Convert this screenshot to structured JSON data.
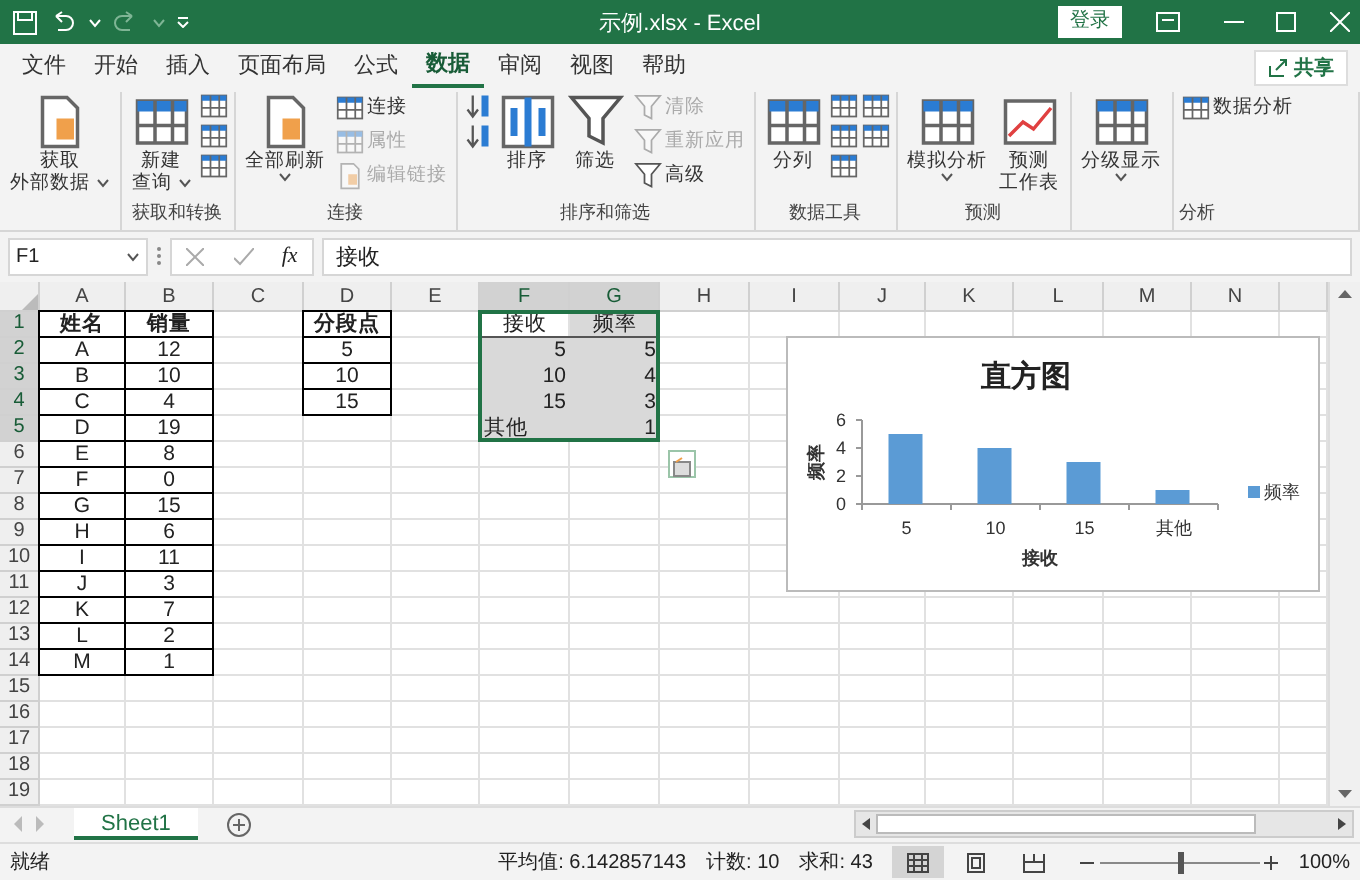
{
  "window": {
    "title": "示例.xlsx  -  Excel",
    "login_button": "登录"
  },
  "ribbon_tabs": [
    {
      "label": "文件",
      "selected": false
    },
    {
      "label": "开始",
      "selected": false
    },
    {
      "label": "插入",
      "selected": false
    },
    {
      "label": "页面布局",
      "selected": false
    },
    {
      "label": "公式",
      "selected": false
    },
    {
      "label": "数据",
      "selected": true
    },
    {
      "label": "审阅",
      "selected": false
    },
    {
      "label": "视图",
      "selected": false
    },
    {
      "label": "帮助",
      "selected": false
    }
  ],
  "share_button": "共享",
  "ribbon_groups": [
    {
      "commands": [
        {
          "kind": "large",
          "lines": [
            "获取",
            "外部数据"
          ],
          "dropdown": true
        }
      ]
    },
    {
      "label": "获取和转换",
      "commands": [
        {
          "kind": "large",
          "lines": [
            "新建",
            "查询"
          ],
          "dropdown": true
        },
        {
          "kind": "icon"
        },
        {
          "kind": "icon"
        },
        {
          "kind": "icon"
        }
      ]
    },
    {
      "label": "连接",
      "commands": [
        {
          "kind": "large",
          "lines": [
            "全部刷新"
          ],
          "dropdown": true
        },
        {
          "kind": "small",
          "label": "连接",
          "disabled": false
        },
        {
          "kind": "small",
          "label": "属性",
          "disabled": true
        },
        {
          "kind": "small",
          "label": "编辑链接",
          "disabled": true
        }
      ]
    },
    {
      "label": "排序和筛选",
      "commands": [
        {
          "kind": "icon"
        },
        {
          "kind": "icon"
        },
        {
          "kind": "large",
          "lines": [
            "排序"
          ]
        },
        {
          "kind": "large",
          "lines": [
            "筛选"
          ]
        },
        {
          "kind": "small",
          "label": "清除",
          "disabled": true
        },
        {
          "kind": "small",
          "label": "重新应用",
          "disabled": true
        },
        {
          "kind": "small",
          "label": "高级",
          "disabled": false
        }
      ]
    },
    {
      "label": "数据工具",
      "commands": [
        {
          "kind": "large",
          "lines": [
            "分列"
          ]
        },
        {
          "kind": "icon"
        },
        {
          "kind": "icon"
        },
        {
          "kind": "icon"
        },
        {
          "kind": "icon"
        },
        {
          "kind": "icon"
        }
      ]
    },
    {
      "label": "预测",
      "commands": [
        {
          "kind": "large",
          "lines": [
            "模拟分析"
          ],
          "dropdown": true
        },
        {
          "kind": "large",
          "lines": [
            "预测",
            "工作表"
          ]
        }
      ]
    },
    {
      "commands": [
        {
          "kind": "large",
          "lines": [
            "分级显示"
          ],
          "dropdown": true
        }
      ]
    },
    {
      "label": "分析",
      "commands": [
        {
          "kind": "small",
          "label": "数据分析",
          "disabled": false
        }
      ]
    }
  ],
  "formula_bar": {
    "name_box": "F1",
    "function_label": "fx",
    "formula": "接收"
  },
  "columns": [
    {
      "label": "A",
      "selected": false
    },
    {
      "label": "B",
      "selected": false
    },
    {
      "label": "C",
      "selected": false
    },
    {
      "label": "D",
      "selected": false
    },
    {
      "label": "E",
      "selected": false
    },
    {
      "label": "F",
      "selected": true
    },
    {
      "label": "G",
      "selected": true
    },
    {
      "label": "H",
      "selected": false
    },
    {
      "label": "I",
      "selected": false
    },
    {
      "label": "J",
      "selected": false
    },
    {
      "label": "K",
      "selected": false
    },
    {
      "label": "L",
      "selected": false
    },
    {
      "label": "M",
      "selected": false
    },
    {
      "label": "N",
      "selected": false
    }
  ],
  "rows": [
    {
      "label": "1",
      "selected": true,
      "cells": [
        {
          "text": "姓名",
          "kind": "header"
        },
        {
          "text": "销量",
          "kind": "header"
        },
        null,
        {
          "text": "分段点",
          "kind": "header"
        },
        null,
        {
          "text": "接收",
          "kind": "title",
          "active": true
        },
        {
          "text": "频率",
          "kind": "title"
        }
      ]
    },
    {
      "label": "2",
      "selected": true,
      "cells": [
        {
          "text": "A",
          "kind": "boxed"
        },
        {
          "text": "12",
          "kind": "boxed"
        },
        null,
        {
          "text": "5",
          "kind": "boxed"
        },
        null,
        {
          "text": "5",
          "kind": "number"
        },
        {
          "text": "5",
          "kind": "number"
        }
      ]
    },
    {
      "label": "3",
      "selected": true,
      "cells": [
        {
          "text": "B",
          "kind": "boxed"
        },
        {
          "text": "10",
          "kind": "boxed"
        },
        null,
        {
          "text": "10",
          "kind": "boxed"
        },
        null,
        {
          "text": "10",
          "kind": "number"
        },
        {
          "text": "4",
          "kind": "number"
        }
      ]
    },
    {
      "label": "4",
      "selected": true,
      "cells": [
        {
          "text": "C",
          "kind": "boxed"
        },
        {
          "text": "4",
          "kind": "boxed"
        },
        null,
        {
          "text": "15",
          "kind": "boxed"
        },
        null,
        {
          "text": "15",
          "kind": "number"
        },
        {
          "text": "3",
          "kind": "number"
        }
      ]
    },
    {
      "label": "5",
      "selected": true,
      "cells": [
        {
          "text": "D",
          "kind": "boxed"
        },
        {
          "text": "19",
          "kind": "boxed"
        },
        null,
        null,
        null,
        {
          "text": "其他",
          "kind": "text"
        },
        {
          "text": "1",
          "kind": "number"
        }
      ]
    },
    {
      "label": "6",
      "selected": false,
      "cells": [
        {
          "text": "E",
          "kind": "boxed"
        },
        {
          "text": "8",
          "kind": "boxed"
        }
      ]
    },
    {
      "label": "7",
      "selected": false,
      "cells": [
        {
          "text": "F",
          "kind": "boxed"
        },
        {
          "text": "0",
          "kind": "boxed"
        }
      ]
    },
    {
      "label": "8",
      "selected": false,
      "cells": [
        {
          "text": "G",
          "kind": "boxed"
        },
        {
          "text": "15",
          "kind": "boxed"
        }
      ]
    },
    {
      "label": "9",
      "selected": false,
      "cells": [
        {
          "text": "H",
          "kind": "boxed"
        },
        {
          "text": "6",
          "kind": "boxed"
        }
      ]
    },
    {
      "label": "10",
      "selected": false,
      "cells": [
        {
          "text": "I",
          "kind": "boxed"
        },
        {
          "text": "11",
          "kind": "boxed"
        }
      ]
    },
    {
      "label": "11",
      "selected": false,
      "cells": [
        {
          "text": "J",
          "kind": "boxed"
        },
        {
          "text": "3",
          "kind": "boxed"
        }
      ]
    },
    {
      "label": "12",
      "selected": false,
      "cells": [
        {
          "text": "K",
          "kind": "boxed"
        },
        {
          "text": "7",
          "kind": "boxed"
        }
      ]
    },
    {
      "label": "13",
      "selected": false,
      "cells": [
        {
          "text": "L",
          "kind": "boxed"
        },
        {
          "text": "2",
          "kind": "boxed"
        }
      ]
    },
    {
      "label": "14",
      "selected": false,
      "cells": [
        {
          "text": "M",
          "kind": "boxed"
        },
        {
          "text": "1",
          "kind": "boxed"
        }
      ]
    },
    {
      "label": "15",
      "selected": false
    },
    {
      "label": "16",
      "selected": false
    },
    {
      "label": "17",
      "selected": false
    },
    {
      "label": "18",
      "selected": false
    },
    {
      "label": "19",
      "selected": false
    }
  ],
  "chart": {
    "chart_data": {
      "type": "bar",
      "title": "直方图",
      "xlabel": "接收",
      "ylabel": "频率",
      "categories": [
        "5",
        "10",
        "15",
        "其他"
      ],
      "series": [
        {
          "name": "频率",
          "color": "#5b9bd5",
          "values": [
            5,
            4,
            3,
            1
          ]
        }
      ],
      "ylim": [
        0,
        6
      ],
      "yticks": [
        0,
        2,
        4,
        6
      ]
    }
  },
  "sheet_tabs": [
    {
      "label": "Sheet1",
      "selected": true
    }
  ],
  "status_bar": {
    "ready": "就绪",
    "stats": [
      "平均值: 6.142857143",
      "计数: 10",
      "求和: 43"
    ],
    "view_buttons": [
      {
        "selected": true
      },
      {
        "selected": false
      },
      {
        "selected": false
      }
    ],
    "zoom_slider": {
      "level": 0.5
    },
    "zoom": "100%"
  }
}
